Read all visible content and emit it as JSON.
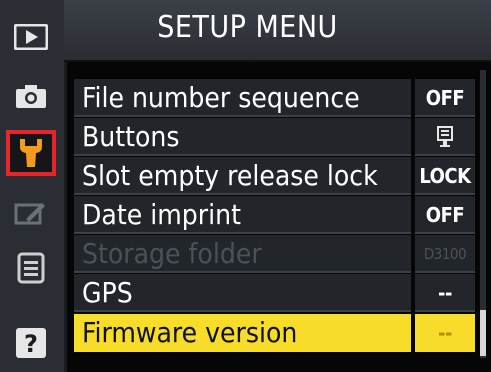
{
  "header": {
    "title": "SETUP MENU"
  },
  "tabs": [
    {
      "name": "playback",
      "icon": "play-icon"
    },
    {
      "name": "shooting",
      "icon": "camera-icon"
    },
    {
      "name": "setup",
      "icon": "wrench-icon",
      "active": true,
      "highlight_color": "#e8242a"
    },
    {
      "name": "retouch",
      "icon": "brush-icon"
    },
    {
      "name": "recent",
      "icon": "list-icon"
    },
    {
      "name": "help",
      "icon": "help-icon",
      "text": "?"
    }
  ],
  "menu": {
    "items": [
      {
        "label": "File number sequence",
        "value": "OFF"
      },
      {
        "label": "Buttons",
        "value_icon": "card-icon"
      },
      {
        "label": "Slot empty release lock",
        "value": "LOCK"
      },
      {
        "label": "Date imprint",
        "value": "OFF"
      },
      {
        "label": "Storage folder",
        "value": "D3100",
        "disabled": true
      },
      {
        "label": "GPS",
        "value": "--"
      },
      {
        "label": "Firmware version",
        "value": "--",
        "selected": true
      }
    ]
  },
  "colors": {
    "selection": "#f7dc2a",
    "tab_highlight": "#e8242a",
    "text": "#ffffff",
    "disabled_text": "#4c5058"
  }
}
